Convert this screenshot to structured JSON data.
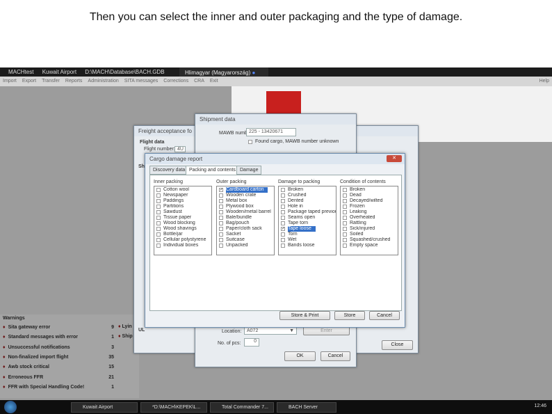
{
  "caption": "Then you can select the inner and outer packaging and the type of damage.",
  "app": {
    "title_parts": [
      "MACHtest",
      "Kuwait Airport",
      "D:\\MACH\\Database\\BACH.GDB"
    ],
    "user": "Hlimagyar (Magyarország)",
    "menu": [
      "Import",
      "Export",
      "Transfer",
      "Reports",
      "Administration",
      "SITA messages",
      "Corrections",
      "CRA",
      "Exit"
    ],
    "help": "Help"
  },
  "freight_window": {
    "title": "Freight acceptance fo",
    "flight_data": "Flight data",
    "flight_number_label": "Flight number:",
    "flight_number": "4U",
    "section_s": "Sh",
    "section_ul": "UL",
    "close": "Close"
  },
  "shipment": {
    "title": "Shipment data",
    "mawb_label": "MAWB number:",
    "mawb": "225 - 13420671",
    "found_cargo": "Found cargo, MAWB number unknown",
    "location_label": "Location:",
    "location": "A072",
    "enter": "Enter",
    "pcs_label": "No. of pcs:",
    "pcs": "0",
    "ok": "OK",
    "cancel": "Cancel"
  },
  "damage": {
    "title": "Cargo damage report",
    "tabs": [
      "Discovery data",
      "Packing and contents",
      "Damage"
    ],
    "columns": [
      {
        "header": "Inner packing",
        "items": [
          {
            "label": "Cotton wool"
          },
          {
            "label": "Newspaper"
          },
          {
            "label": "Paddings"
          },
          {
            "label": "Partitions"
          },
          {
            "label": "Sawdust"
          },
          {
            "label": "Tissue paper"
          },
          {
            "label": "Wood blocking"
          },
          {
            "label": "Wood shavings"
          },
          {
            "label": "Bottle/jar"
          },
          {
            "label": "Cellular polystyrene"
          },
          {
            "label": "Individual boxes"
          }
        ]
      },
      {
        "header": "Outer packing",
        "items": [
          {
            "label": "Cardboard carton",
            "checked": true
          },
          {
            "label": "Wooden crate"
          },
          {
            "label": "Metal box"
          },
          {
            "label": "Plywood box"
          },
          {
            "label": "Wooden/metal barrel"
          },
          {
            "label": "Bale/bundle"
          },
          {
            "label": "Bag/pouch"
          },
          {
            "label": "Paper/cloth sack"
          },
          {
            "label": "Sacket"
          },
          {
            "label": "Suitcase"
          },
          {
            "label": "Unpacked"
          }
        ]
      },
      {
        "header": "Damage to packing",
        "items": [
          {
            "label": "Broken"
          },
          {
            "label": "Crushed"
          },
          {
            "label": "Dented"
          },
          {
            "label": "Hole in"
          },
          {
            "label": "Package taped previous"
          },
          {
            "label": "Seams open"
          },
          {
            "label": "Tape torn"
          },
          {
            "label": "Tape loose",
            "checked": true
          },
          {
            "label": "Torn"
          },
          {
            "label": "Wet"
          },
          {
            "label": "Bands loose"
          }
        ]
      },
      {
        "header": "Condition of contents",
        "items": [
          {
            "label": "Broken"
          },
          {
            "label": "Dead"
          },
          {
            "label": "Decayed/wilted"
          },
          {
            "label": "Frozen"
          },
          {
            "label": "Leaking"
          },
          {
            "label": "Overheated"
          },
          {
            "label": "Rattling"
          },
          {
            "label": "Sick/injured"
          },
          {
            "label": "Soiled"
          },
          {
            "label": "Squashed/crushed"
          },
          {
            "label": "Empty space"
          }
        ]
      }
    ],
    "store_print": "Store & Print",
    "store": "Store",
    "cancel": "Cancel"
  },
  "warnings": {
    "title": "Warnings",
    "items": [
      {
        "label": "Sita gateway error",
        "count": "9"
      },
      {
        "label": "Standard messages with error",
        "count": "1"
      },
      {
        "label": "Unsuccessful notifications",
        "count": "3"
      },
      {
        "label": "Non-finalized import flight",
        "count": "35"
      },
      {
        "label": "Awb stock critical",
        "count": "15"
      },
      {
        "label": "Erroneous FFR",
        "count": "21"
      },
      {
        "label": "FFR with Special Handling Code!",
        "count": "1"
      }
    ],
    "side": [
      "Lyin",
      "Ship"
    ]
  },
  "taskbar": {
    "tasks": [
      "Kuwait Airport",
      "*D:\\MACH\\KEPEK\\L...",
      "Total Commander 7...",
      "BACH Server"
    ],
    "clock": "12:46"
  }
}
